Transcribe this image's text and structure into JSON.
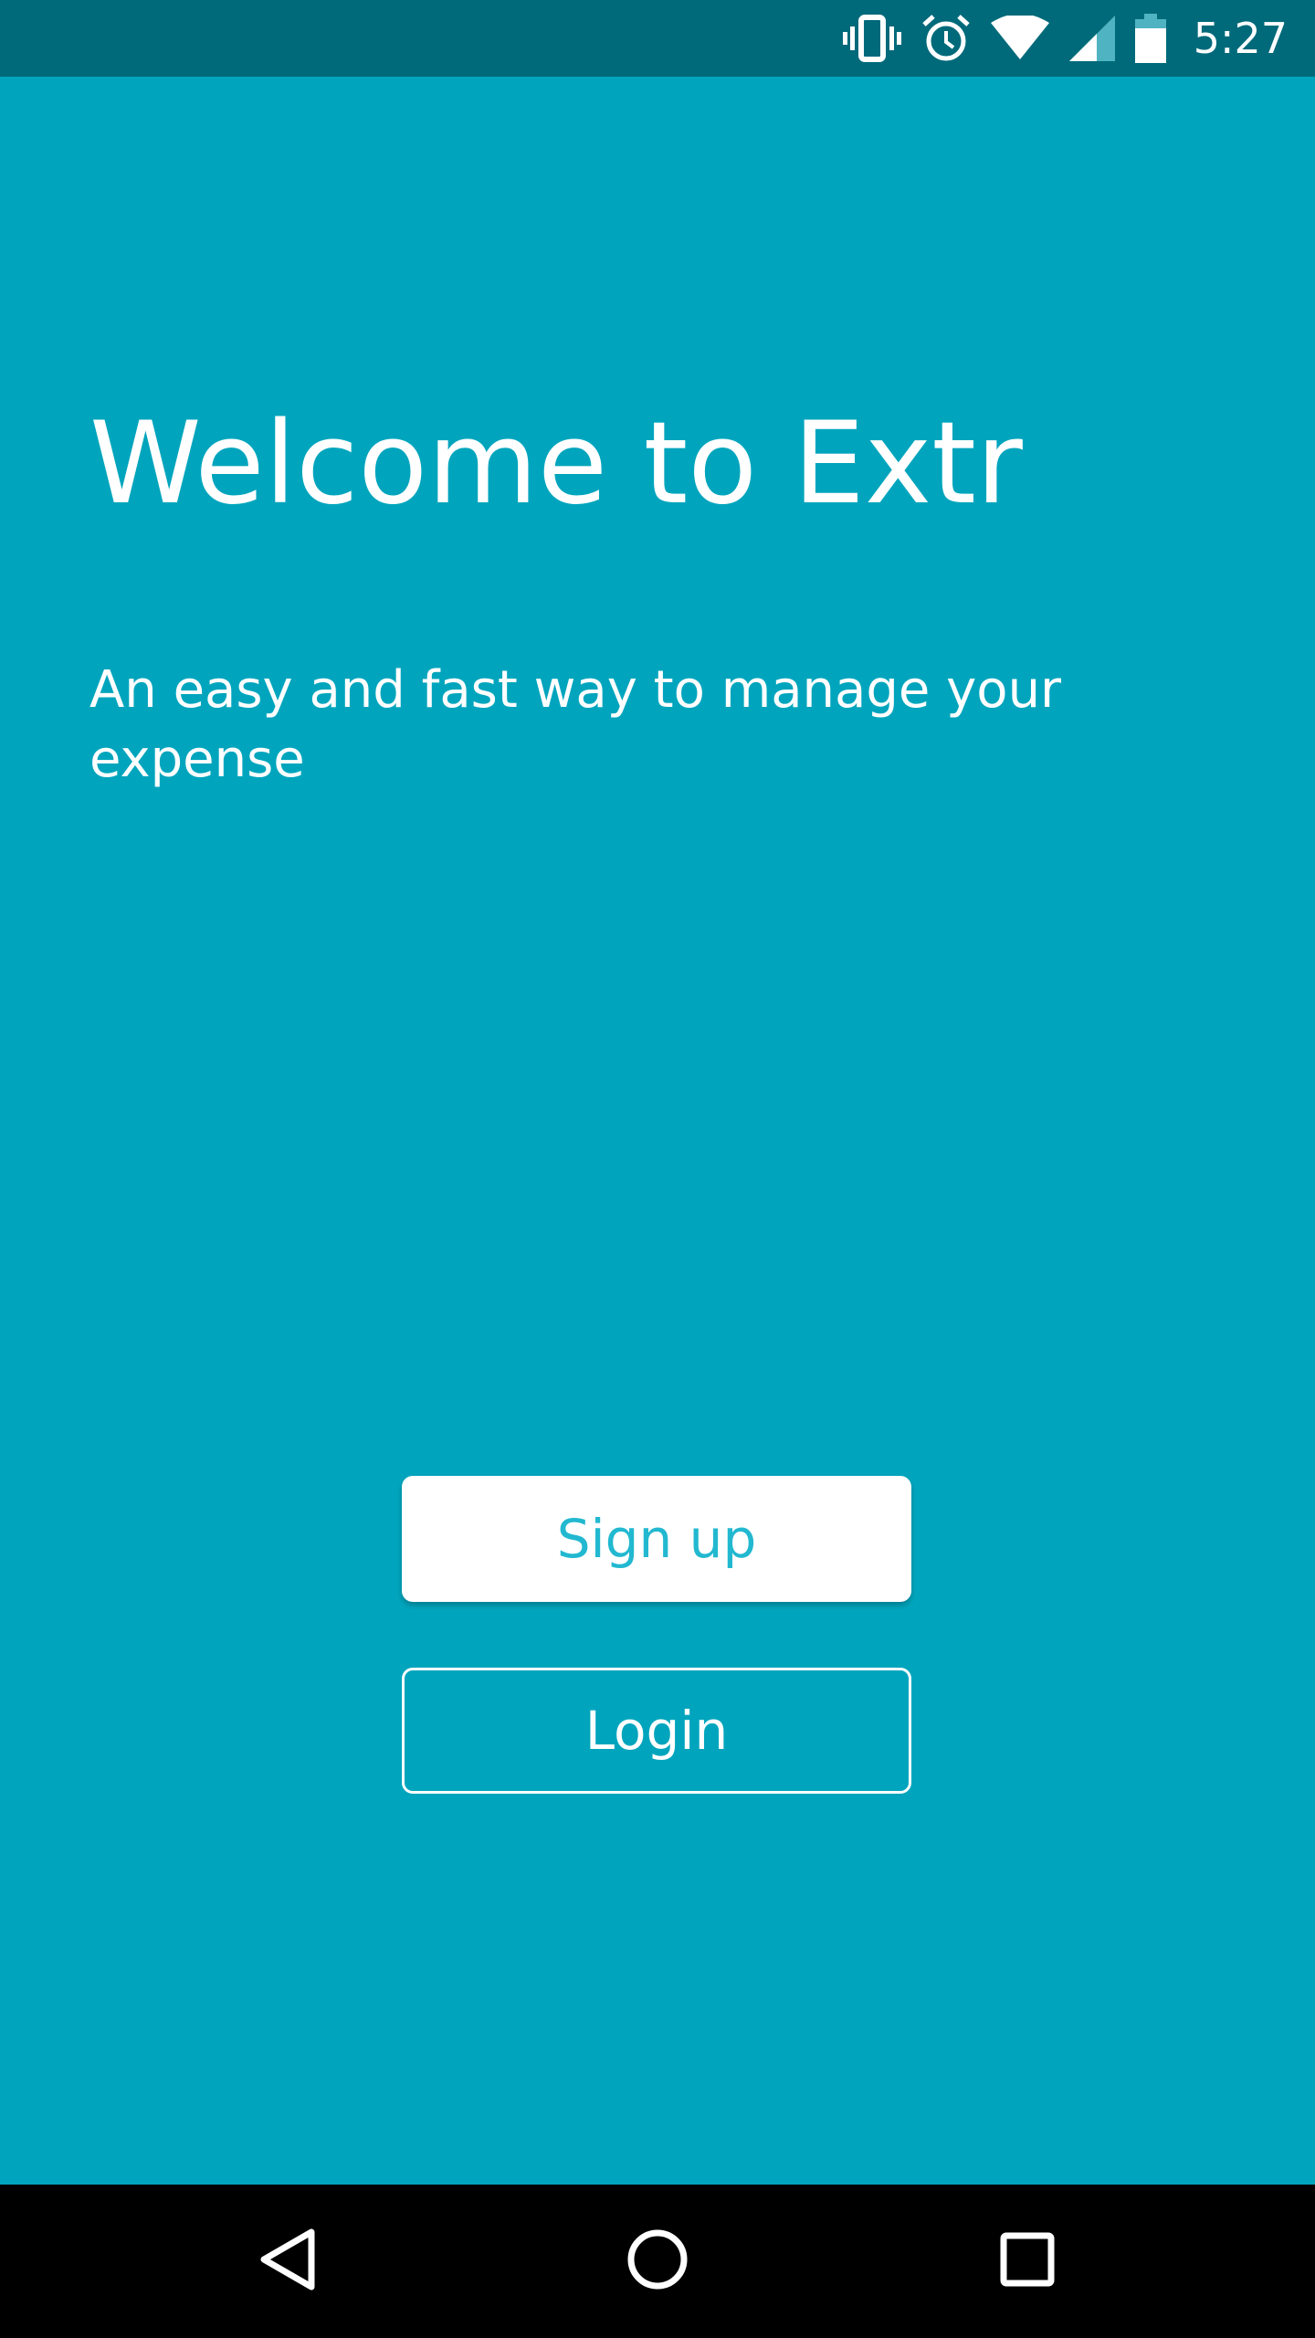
{
  "status_bar": {
    "time": "5:27",
    "icons": [
      "vibrate-icon",
      "alarm-icon",
      "wifi-icon",
      "signal-icon",
      "battery-icon"
    ],
    "background_color": "#006a7a"
  },
  "welcome": {
    "title": "Welcome to Extr",
    "tagline": "An easy and fast way to manage your expense"
  },
  "actions": {
    "signup_label": "Sign up",
    "login_label": "Login"
  },
  "nav_bar": {
    "buttons": [
      "back-icon",
      "home-icon",
      "recents-icon"
    ]
  },
  "colors": {
    "background": "#00a5bd",
    "accent_text": "#22b8d0",
    "white": "#ffffff"
  }
}
